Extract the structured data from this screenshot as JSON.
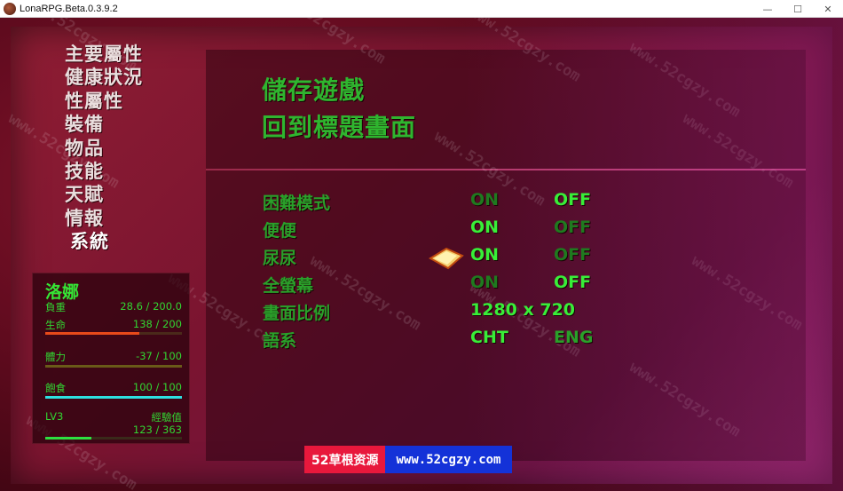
{
  "window": {
    "title": "LonaRPG.Beta.0.3.9.2",
    "controls": [
      "—",
      "☐",
      "✕"
    ]
  },
  "menu": {
    "items": [
      {
        "label": "主要屬性"
      },
      {
        "label": "健康狀況"
      },
      {
        "label": "性屬性"
      },
      {
        "label": "裝備"
      },
      {
        "label": "物品"
      },
      {
        "label": "技能"
      },
      {
        "label": "天賦"
      },
      {
        "label": "情報"
      },
      {
        "label": "系統",
        "selected": true
      }
    ]
  },
  "status": {
    "name": "洛娜",
    "weight": {
      "label": "負重",
      "value": "28.6 / 200.0"
    },
    "health": {
      "label": "生命",
      "value": "138 / 200",
      "fraction": 0.69,
      "color": "#e84a1a"
    },
    "stamina": {
      "label": "體力",
      "value": "-37 / 100",
      "fraction": 0.0,
      "color": "#7a5a1a"
    },
    "food": {
      "label": "飽食",
      "value": "100 / 100",
      "fraction": 1.0,
      "color": "#2ee0e0"
    },
    "level": "LV3",
    "exp": {
      "label": "經驗值",
      "value": "123 / 363",
      "fraction": 0.34,
      "color": "#2ee040"
    }
  },
  "system": {
    "save_label": "儲存遊戲",
    "title_label": "回到標題畫面"
  },
  "settings": {
    "difficulty": {
      "label": "困難模式",
      "on": "ON",
      "off": "OFF",
      "selected": "OFF"
    },
    "scat": {
      "label": "便便",
      "on": "ON",
      "off": "OFF",
      "selected": "ON"
    },
    "urine": {
      "label": "尿尿",
      "on": "ON",
      "off": "OFF",
      "selected": "ON"
    },
    "fullscreen": {
      "label": "全螢幕",
      "on": "ON",
      "off": "OFF",
      "selected": "OFF"
    },
    "resolution": {
      "label": "畫面比例",
      "value": "1280 x 720"
    },
    "language": {
      "label": "語系",
      "opt1": "CHT",
      "opt2": "ENG",
      "selected": "CHT"
    }
  },
  "watermark": {
    "text": "www.52cgzy.com"
  },
  "banner": {
    "left": "52草根资源",
    "right": "www.52cgzy.com"
  },
  "colors": {
    "accent_green": "#38ee38",
    "dim_green": "#1f7a1f",
    "bg_red": "#6a0d22"
  }
}
